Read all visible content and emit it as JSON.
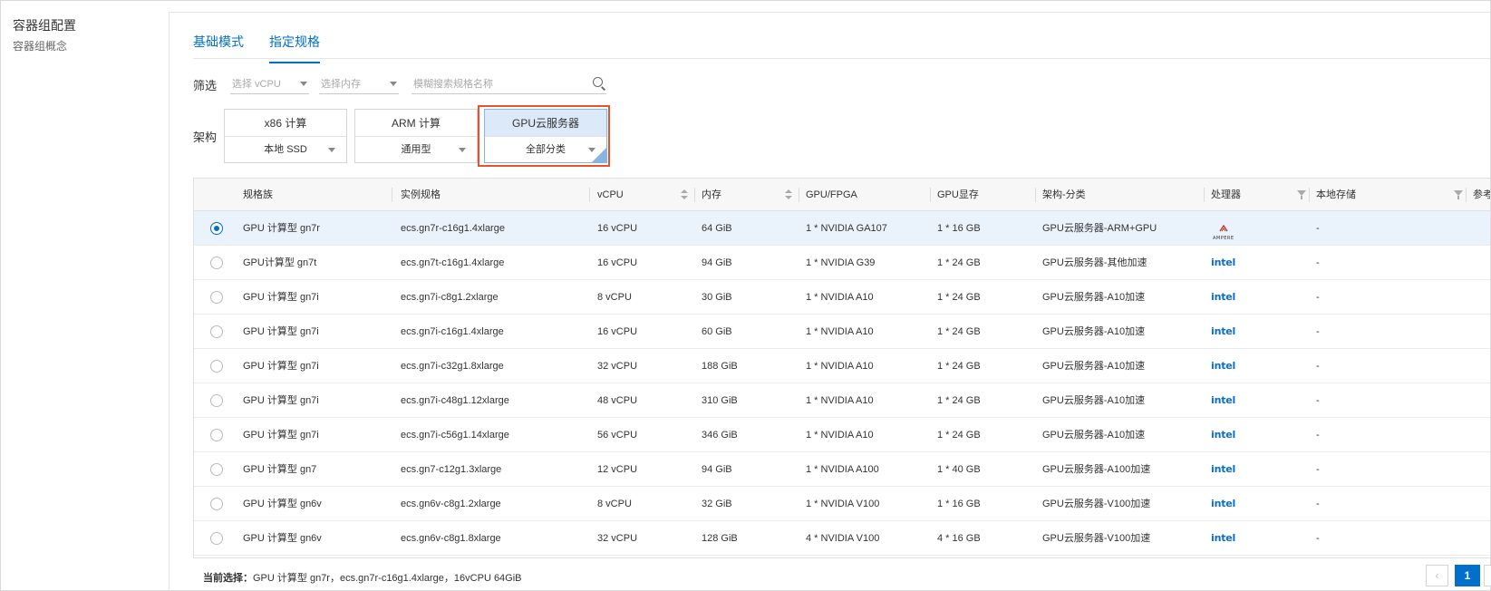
{
  "sidebar": {
    "title": "容器组配置",
    "subtitle": "容器组概念"
  },
  "tabs": [
    {
      "label": "基础模式"
    },
    {
      "label": "指定规格"
    }
  ],
  "filter": {
    "label": "筛选",
    "vcpu_placeholder": "选择 vCPU",
    "memory_placeholder": "选择内存",
    "search_placeholder": "模糊搜索规格名称"
  },
  "architecture": {
    "label": "架构",
    "options": [
      {
        "name": "x86 计算",
        "category": "本地 SSD"
      },
      {
        "name": "ARM 计算",
        "category": "通用型"
      },
      {
        "name": "GPU云服务器",
        "category": "全部分类"
      }
    ]
  },
  "table": {
    "headers": {
      "family": "规格族",
      "instance": "实例规格",
      "vcpu": "vCPU",
      "memory": "内存",
      "gpu": "GPU/FPGA",
      "gpu_mem": "GPU显存",
      "arch": "架构-分类",
      "processor": "处理器",
      "storage": "本地存储",
      "ref": "参考"
    },
    "rows": [
      {
        "family": "GPU 计算型 gn7r",
        "instance": "ecs.gn7r-c16g1.4xlarge",
        "vcpu": "16 vCPU",
        "memory": "64 GiB",
        "gpu": "1 * NVIDIA GA107",
        "gpu_mem": "1 * 16 GB",
        "arch": "GPU云服务器-ARM+GPU",
        "processor": "AMPERE",
        "storage": "-"
      },
      {
        "family": "GPU计算型 gn7t",
        "instance": "ecs.gn7t-c16g1.4xlarge",
        "vcpu": "16 vCPU",
        "memory": "94 GiB",
        "gpu": "1 * NVIDIA G39",
        "gpu_mem": "1 * 24 GB",
        "arch": "GPU云服务器-其他加速",
        "processor": "intel",
        "storage": "-"
      },
      {
        "family": "GPU 计算型 gn7i",
        "instance": "ecs.gn7i-c8g1.2xlarge",
        "vcpu": "8 vCPU",
        "memory": "30 GiB",
        "gpu": "1 * NVIDIA A10",
        "gpu_mem": "1 * 24 GB",
        "arch": "GPU云服务器-A10加速",
        "processor": "intel",
        "storage": "-"
      },
      {
        "family": "GPU 计算型 gn7i",
        "instance": "ecs.gn7i-c16g1.4xlarge",
        "vcpu": "16 vCPU",
        "memory": "60 GiB",
        "gpu": "1 * NVIDIA A10",
        "gpu_mem": "1 * 24 GB",
        "arch": "GPU云服务器-A10加速",
        "processor": "intel",
        "storage": "-"
      },
      {
        "family": "GPU 计算型 gn7i",
        "instance": "ecs.gn7i-c32g1.8xlarge",
        "vcpu": "32 vCPU",
        "memory": "188 GiB",
        "gpu": "1 * NVIDIA A10",
        "gpu_mem": "1 * 24 GB",
        "arch": "GPU云服务器-A10加速",
        "processor": "intel",
        "storage": "-"
      },
      {
        "family": "GPU 计算型 gn7i",
        "instance": "ecs.gn7i-c48g1.12xlarge",
        "vcpu": "48 vCPU",
        "memory": "310 GiB",
        "gpu": "1 * NVIDIA A10",
        "gpu_mem": "1 * 24 GB",
        "arch": "GPU云服务器-A10加速",
        "processor": "intel",
        "storage": "-"
      },
      {
        "family": "GPU 计算型 gn7i",
        "instance": "ecs.gn7i-c56g1.14xlarge",
        "vcpu": "56 vCPU",
        "memory": "346 GiB",
        "gpu": "1 * NVIDIA A10",
        "gpu_mem": "1 * 24 GB",
        "arch": "GPU云服务器-A10加速",
        "processor": "intel",
        "storage": "-"
      },
      {
        "family": "GPU 计算型 gn7",
        "instance": "ecs.gn7-c12g1.3xlarge",
        "vcpu": "12 vCPU",
        "memory": "94 GiB",
        "gpu": "1 * NVIDIA A100",
        "gpu_mem": "1 * 40 GB",
        "arch": "GPU云服务器-A100加速",
        "processor": "intel",
        "storage": "-"
      },
      {
        "family": "GPU 计算型 gn6v",
        "instance": "ecs.gn6v-c8g1.2xlarge",
        "vcpu": "8 vCPU",
        "memory": "32 GiB",
        "gpu": "1 * NVIDIA V100",
        "gpu_mem": "1 * 16 GB",
        "arch": "GPU云服务器-V100加速",
        "processor": "intel",
        "storage": "-"
      },
      {
        "family": "GPU 计算型 gn6v",
        "instance": "ecs.gn6v-c8g1.8xlarge",
        "vcpu": "32 vCPU",
        "memory": "128 GiB",
        "gpu": "4 * NVIDIA V100",
        "gpu_mem": "4 * 16 GB",
        "arch": "GPU云服务器-V100加速",
        "processor": "intel",
        "storage": "-"
      }
    ]
  },
  "footer": {
    "label": "当前选择：",
    "value": "GPU 计算型 gn7r，ecs.gn7r-c16g1.4xlarge，16vCPU 64GiB"
  },
  "pagination": {
    "current": "1"
  },
  "colors": {
    "accent": "#0070cc",
    "highlight": "#e4532e",
    "selected_row": "#eaf3fc"
  }
}
